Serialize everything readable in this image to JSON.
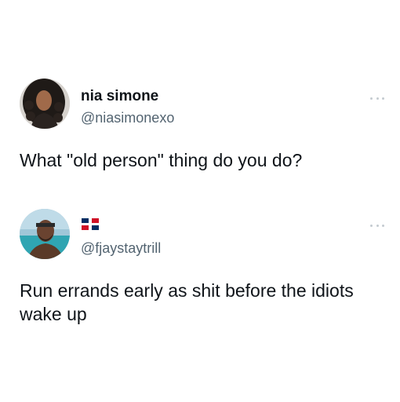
{
  "tweets": [
    {
      "name": "nia simone",
      "handle": "@niasimonexo",
      "text": "What \"old person\" thing do you do?",
      "avatar_icon": "profile-photo-woman-curly-hair"
    },
    {
      "name": "",
      "flag_icon": "dominican-republic-flag-icon",
      "handle": "@fjaystaytrill",
      "text": "Run errands early as shit before the idiots wake up",
      "avatar_icon": "profile-photo-man-beach"
    }
  ],
  "colors": {
    "text": "#0f1419",
    "secondary": "#536471",
    "more_dots": "#c4cbd0"
  }
}
